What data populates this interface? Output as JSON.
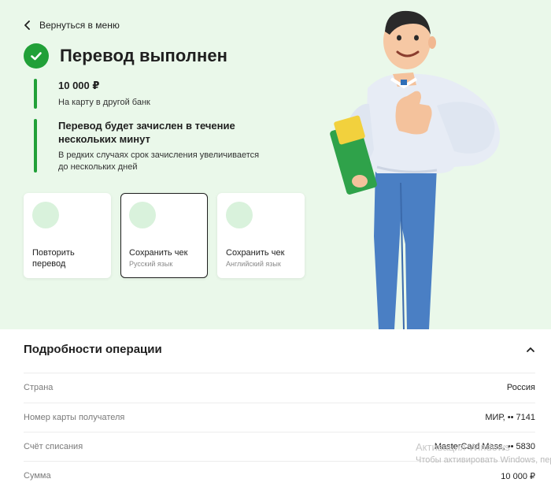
{
  "nav": {
    "back_label": "Вернуться в меню"
  },
  "status": {
    "title": "Перевод выполнен"
  },
  "amount_block": {
    "amount": "10 000 ₽",
    "subtitle": "На карту в другой банк"
  },
  "timing_block": {
    "title_line1": "Перевод будет зачислен в течение",
    "title_line2": "нескольких минут",
    "note_line1": "В редких случаях срок зачисления увеличивается",
    "note_line2": "до нескольких дней"
  },
  "actions": [
    {
      "label_line1": "Повторить",
      "label_line2": "перевод",
      "sub": ""
    },
    {
      "label_line1": "Сохранить чек",
      "label_line2": "",
      "sub": "Русский язык"
    },
    {
      "label_line1": "Сохранить чек",
      "label_line2": "",
      "sub": "Английский язык"
    }
  ],
  "details": {
    "title": "Подробности операции",
    "rows": [
      {
        "label": "Страна",
        "value": "Россия"
      },
      {
        "label": "Номер карты получателя",
        "value": "МИР, •• 7141"
      },
      {
        "label": "Счёт списания",
        "value": "MasterCard Mass, •• 5830"
      },
      {
        "label": "Сумма",
        "value": "10 000 ₽"
      }
    ]
  },
  "watermark": {
    "title": "Активация Windows",
    "text": "Чтобы активировать Windows, пере"
  },
  "colors": {
    "accent": "#21a038",
    "hero_bg": "#eaf8ea",
    "card_circle": "#d9f2dc"
  }
}
